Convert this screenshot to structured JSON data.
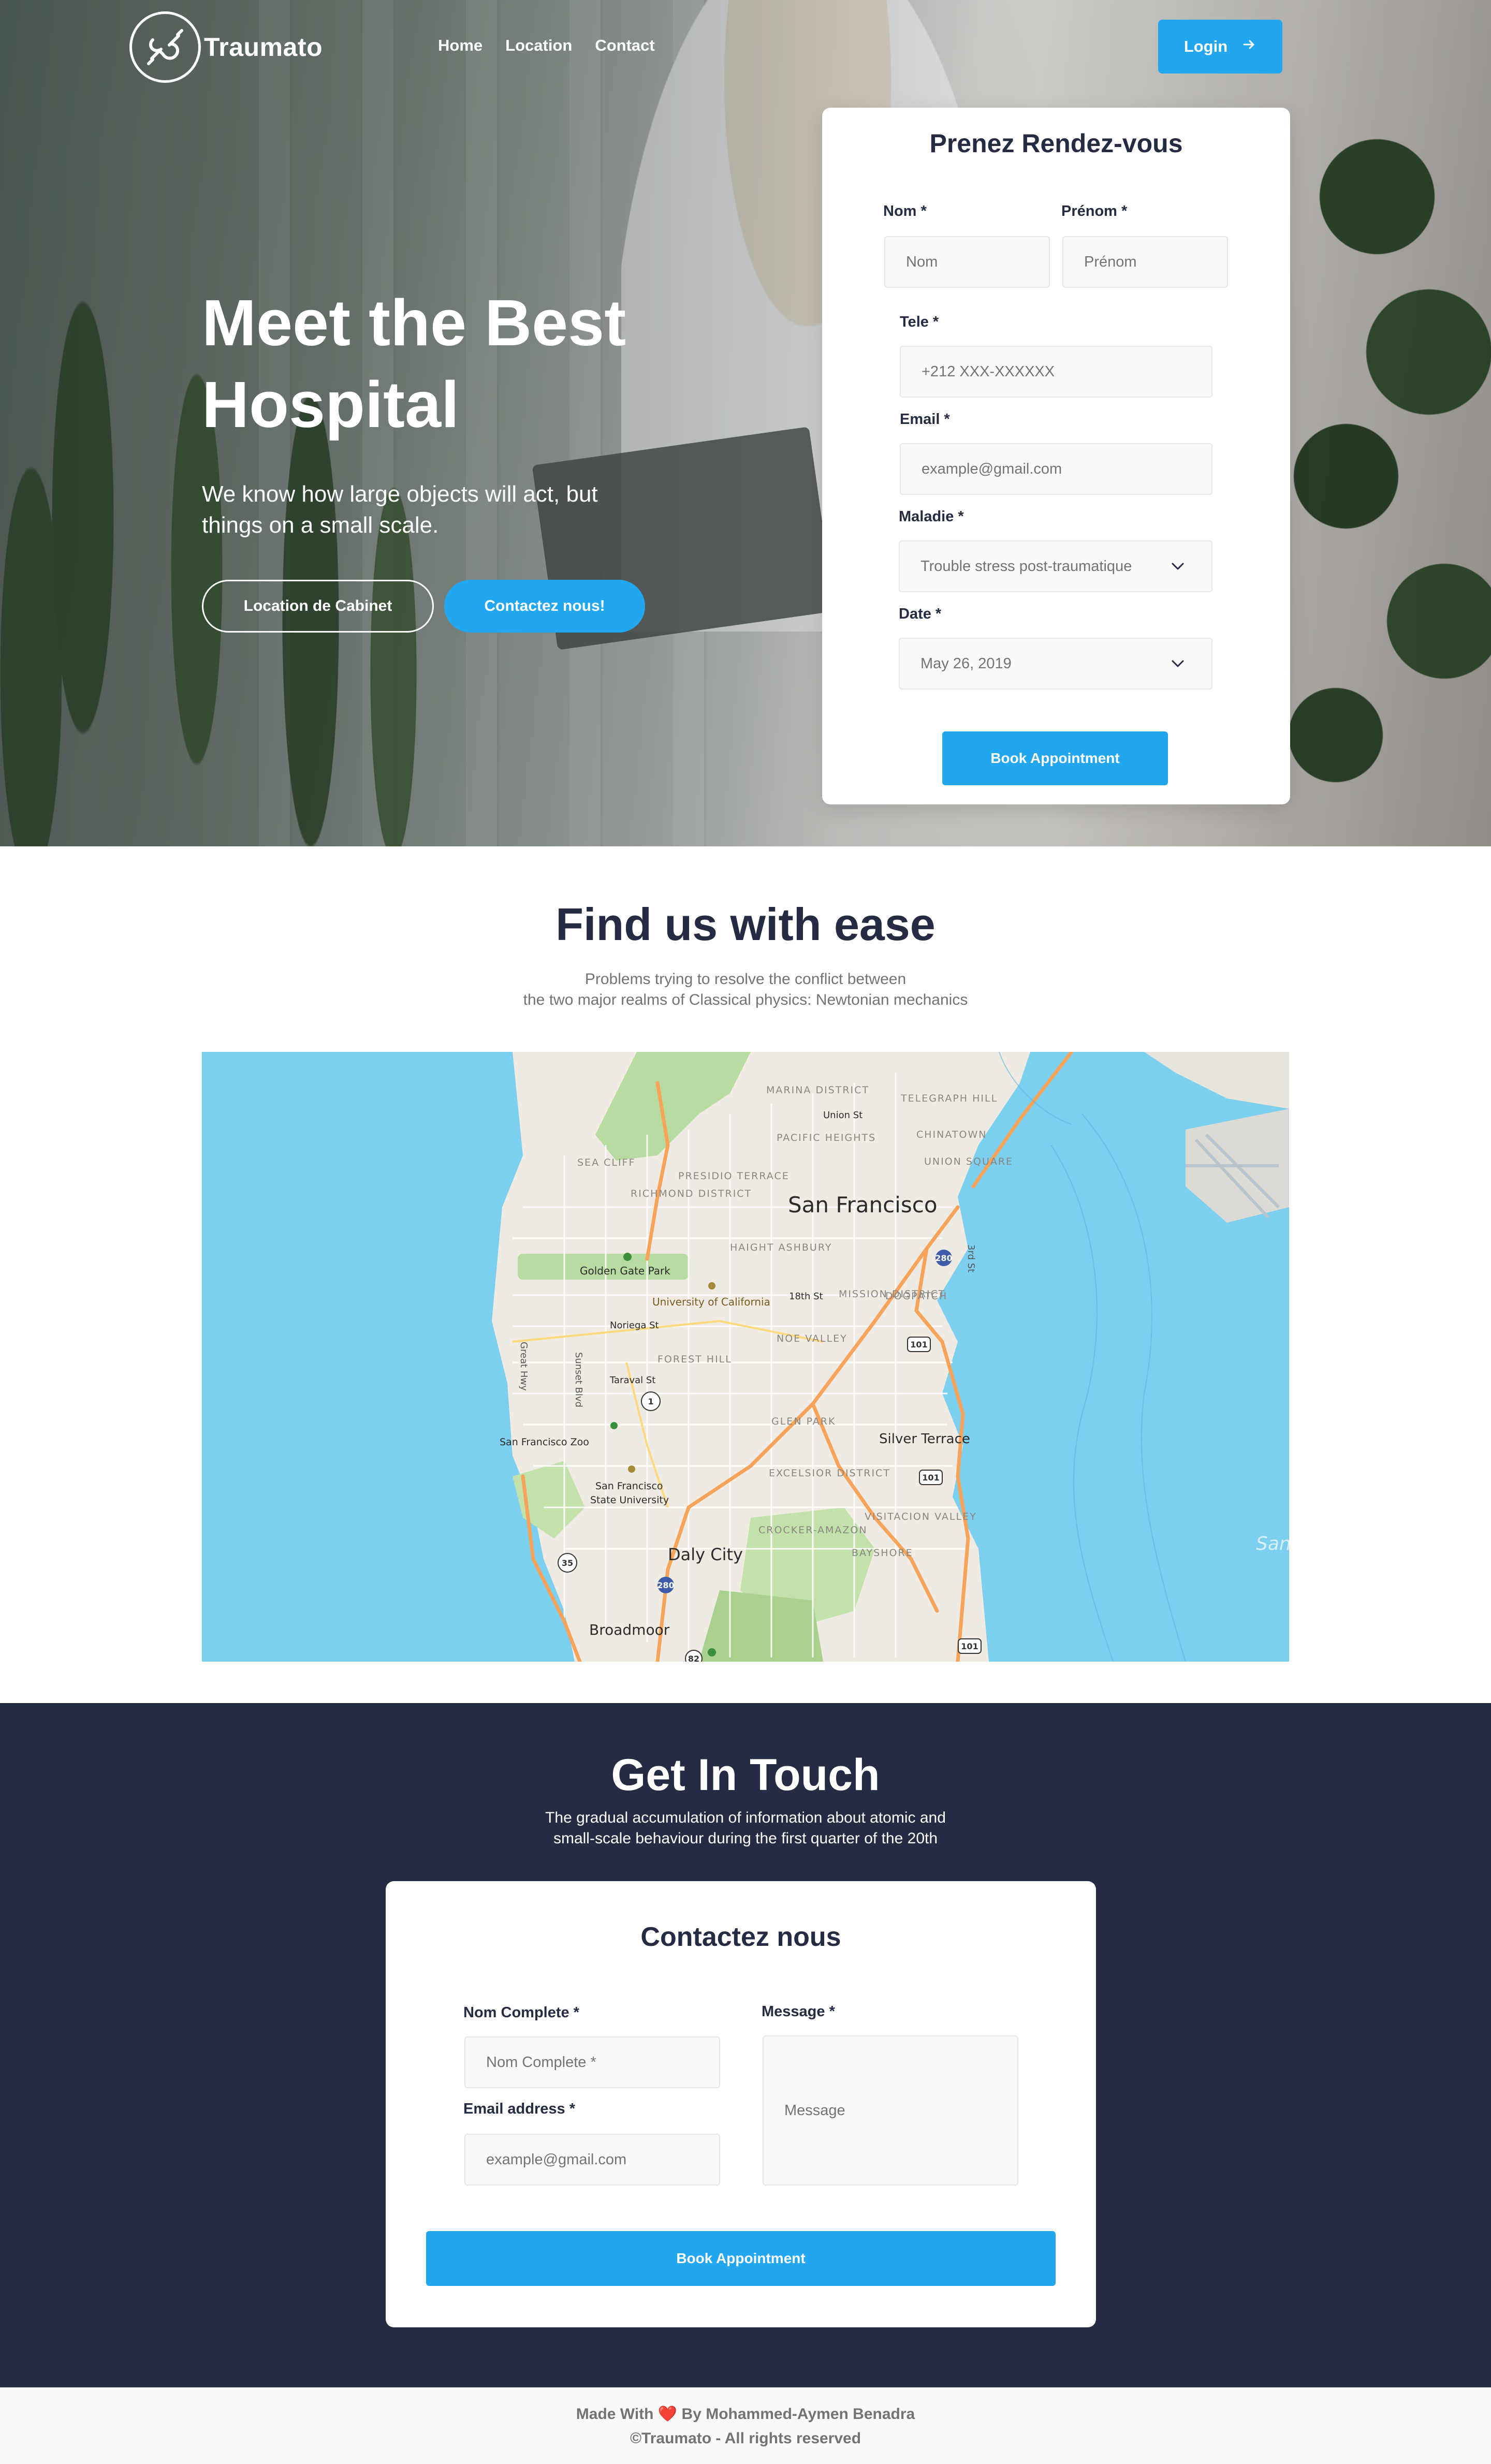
{
  "brand": {
    "name": "Traumato"
  },
  "nav": {
    "items": [
      "Home",
      "Location",
      "Contact"
    ]
  },
  "header": {
    "login_label": "Login"
  },
  "hero": {
    "title": "Meet the Best Hospital",
    "subtitle": "We know how large objects will act, but things on a small scale.",
    "btn_location": "Location de Cabinet",
    "btn_contact": "Contactez nous!"
  },
  "appointment": {
    "title": "Prenez Rendez-vous",
    "nom_label": "Nom *",
    "nom_placeholder": "Nom",
    "prenom_label": "Prénom *",
    "prenom_placeholder": "Prénom",
    "tele_label": "Tele *",
    "tele_placeholder": "+212 XXX-XXXXXX",
    "email_label": "Email *",
    "email_placeholder": "example@gmail.com",
    "maladie_label": "Maladie *",
    "maladie_value": "Trouble stress post-traumatique",
    "date_label": "Date *",
    "date_value": "May 26, 2019",
    "submit_label": "Book Appointment"
  },
  "find": {
    "title": "Find us with ease",
    "subtitle_line1": "Problems trying to resolve the conflict between",
    "subtitle_line2": "the two major realms of Classical physics: Newtonian mechanics"
  },
  "map": {
    "labels": {
      "san_francisco": "San Francisco",
      "daly_city": "Daly City",
      "silver_terrace": "Silver Terrace",
      "broadmoor": "Broadmoor",
      "golden_gate_park": "Golden Gate Park",
      "ucsf": "University of California",
      "sf_zoo": "San Francisco Zoo",
      "sfsu_1": "San Francisco",
      "sfsu_2": "State University",
      "marina": "MARINA DISTRICT",
      "pacific_heights": "PACIFIC HEIGHTS",
      "richmond": "RICHMOND DISTRICT",
      "mission": "MISSION DISTRICT",
      "noe_valley": "NOE VALLEY",
      "glen_park": "GLEN PARK",
      "excelsior": "EXCELSIOR DISTRICT",
      "bayshore": "BAYSHORE",
      "haight": "HAIGHT ASHBURY",
      "dogpatch": "DOGPATCH",
      "forest_hill": "FOREST HILL",
      "visitacion": "VISITACION VALLEY",
      "crocker": "CROCKER-AMAZON",
      "telegraph": "TELEGRAPH HILL",
      "chinatown": "CHINATOWN",
      "union_square": "UNION SQUARE",
      "presidio": "PRESIDIO TERRACE",
      "sea_cliff": "SEA CLIFF",
      "union_st": "Union St",
      "noriega": "Noriega St",
      "taraval": "Taraval St",
      "sunset": "Sunset Blvd",
      "great_hwy": "Great Hwy",
      "third_st": "3rd St",
      "eighteenth": "18th St",
      "san": "San"
    },
    "shields": [
      "101",
      "101",
      "101",
      "280",
      "280",
      "35",
      "1",
      "82"
    ]
  },
  "touch": {
    "title": "Get In Touch",
    "subtitle_line1": "The gradual accumulation of information about atomic and",
    "subtitle_line2": "small-scale behaviour during the first quarter of the 20th"
  },
  "contact": {
    "title": "Contactez nous",
    "name_label": "Nom Complete *",
    "name_placeholder": "Nom Complete *",
    "email_label": "Email address *",
    "email_placeholder": "example@gmail.com",
    "message_label": "Message *",
    "message_placeholder": "Message",
    "submit_label": "Book Appointment"
  },
  "footer": {
    "made_with": "Made With",
    "heart": "❤️",
    "by": "By Mohammed-Aymen Benadra",
    "copyright": "©Traumato - All rights reserved"
  },
  "colors": {
    "primary": "#23A6F0",
    "dark": "#252B42",
    "muted": "#737373",
    "map_water": "#7dcff0",
    "map_land": "#efeae2"
  }
}
